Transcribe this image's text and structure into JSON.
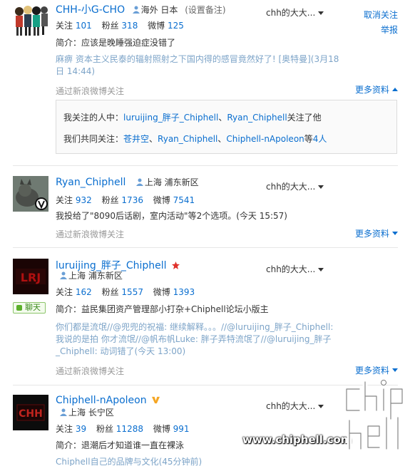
{
  "users": [
    {
      "name": "CHH-小G-CHO",
      "location": "海外 日本",
      "remark": "(设置备注)",
      "group": "chh的大大...",
      "actions": [
        "取消关注",
        "举报"
      ],
      "stats": {
        "follow_label": "关注",
        "follow": "101",
        "fans_label": "粉丝",
        "fans": "318",
        "weibo_label": "微博",
        "weibo": "125"
      },
      "intro": "简介：应该是晚睡强迫症没错了",
      "repost": "麻痹 资本主义民泰的辐射照射之下国内得的感冒竟然好了! [奥特曼](3月18日 14:44)",
      "via": "通过新浪微博关注",
      "more": "更多资料",
      "detail": {
        "row1_prefix": "我关注的人中：",
        "row1_links": [
          "luruijing_胖子_Chiphell",
          "Ryan_Chiphell"
        ],
        "row1_sep": "、",
        "row1_suffix": "关注了他",
        "row2_prefix": "我们共同关注：",
        "row2_links": [
          "苍井空",
          "Ryan_Chiphell",
          "Chiphell-nApoleon"
        ],
        "row2_suffix": "等",
        "row2_count": "4人"
      }
    },
    {
      "name": "Ryan_Chiphell",
      "location": "上海 浦东新区",
      "group": "chh的大大...",
      "stats": {
        "follow_label": "关注",
        "follow": "932",
        "fans_label": "粉丝",
        "fans": "1736",
        "weibo_label": "微博",
        "weibo": "7541"
      },
      "line": "我投给了\"8090后话剧，室内活动\"等2个选项。(今天 15:57)",
      "via": "通过新浪微博关注",
      "more": "更多资料"
    },
    {
      "name": "luruijing_胖子_Chiphell",
      "location": "上海 浦东新区",
      "group": "chh的大大...",
      "chat": "聊天",
      "stats": {
        "follow_label": "关注",
        "follow": "162",
        "fans_label": "粉丝",
        "fans": "1557",
        "weibo_label": "微博",
        "weibo": "1393"
      },
      "intro": "简介：益民集团资产管理部小打杂+Chiphell论坛小版主",
      "repost_lines": [
        "你们都是流氓//@兜兜的祝福: 继续解释。。。//@luruijing_胖子_Chiphell:",
        "我说的是拍 你才流氓//@帆布帆Luke: 胖子弄特流氓了//@luruijing_胖子",
        "_Chiphell: 动词错了(今天 13:00)"
      ],
      "via": "通过新浪微博关注",
      "more": "更多资料"
    },
    {
      "name": "Chiphell-nApoleon",
      "location": "上海 长宁区",
      "group": "chh的大大...",
      "stats": {
        "follow_label": "关注",
        "follow": "39",
        "fans_label": "粉丝",
        "fans": "11288",
        "weibo_label": "微博",
        "weibo": "991"
      },
      "intro": "简介：退潮后才知道谁一直在裸泳",
      "repost": "Chiphell自己的品牌与文化(45分钟前)"
    }
  ],
  "watermark": {
    "url": "www.chiphell.com",
    "logo": "chip hell"
  },
  "colors": {
    "link": "#0a6ecf",
    "muted": "#999999",
    "repost": "#7da4c8"
  }
}
